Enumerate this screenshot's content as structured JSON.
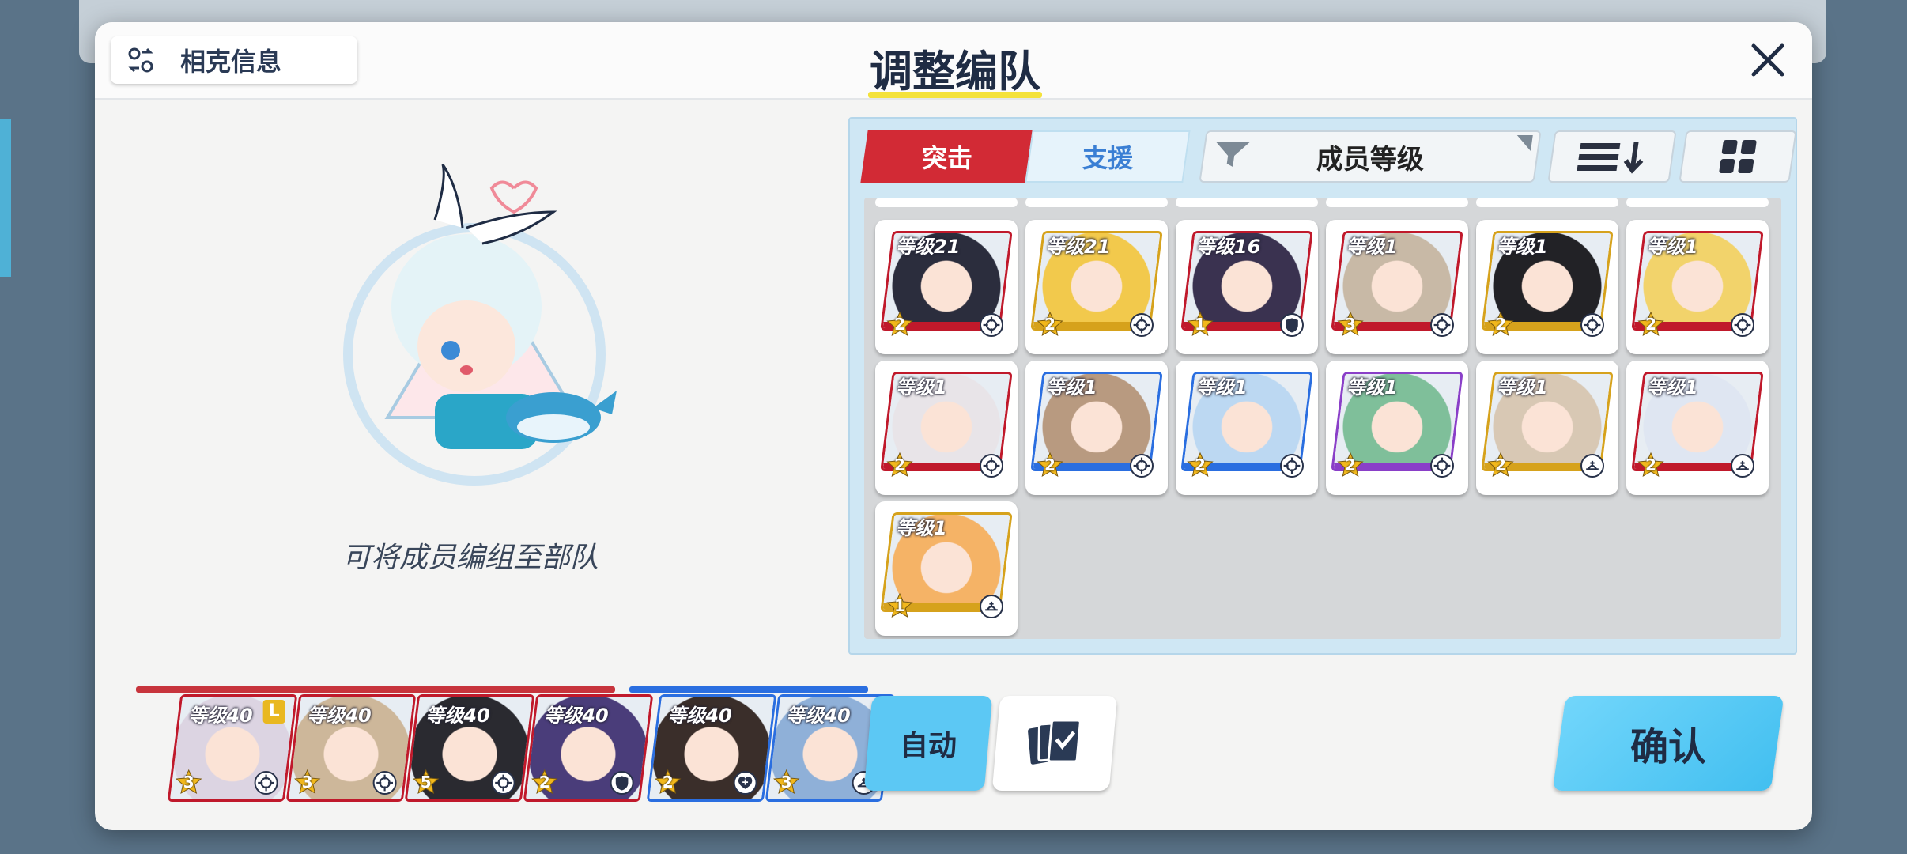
{
  "header": {
    "matchup_label": "相克信息",
    "title": "调整编队"
  },
  "left": {
    "hint": "可将成员编组至部队"
  },
  "filter": {
    "strike_label": "突击",
    "support_label": "支援",
    "sort_key": "成员等级"
  },
  "roster": [
    {
      "level": "等级21",
      "stars": "2",
      "role": "crosshair-icon",
      "frame": "#c0192b",
      "art": "#2b2d3d"
    },
    {
      "level": "等级21",
      "stars": "2",
      "role": "crosshair-icon",
      "frame": "#d6a21c",
      "art": "#f2c94c"
    },
    {
      "level": "等级16",
      "stars": "1",
      "role": "shield-icon",
      "frame": "#c0192b",
      "art": "#3a3250"
    },
    {
      "level": "等级1",
      "stars": "3",
      "role": "crosshair-icon",
      "frame": "#c0192b",
      "art": "#c8b9a6"
    },
    {
      "level": "等级1",
      "stars": "2",
      "role": "crosshair-icon",
      "frame": "#d6a21c",
      "art": "#222226"
    },
    {
      "level": "等级1",
      "stars": "2",
      "role": "crosshair-icon",
      "frame": "#c0192b",
      "art": "#f2d36b"
    },
    {
      "level": "等级1",
      "stars": "2",
      "role": "crosshair-icon",
      "frame": "#c0192b",
      "art": "#e8e4e8"
    },
    {
      "level": "等级1",
      "stars": "2",
      "role": "crosshair-icon",
      "frame": "#2a6ee0",
      "art": "#b89a80"
    },
    {
      "level": "等级1",
      "stars": "2",
      "role": "crosshair-icon",
      "frame": "#2a6ee0",
      "art": "#bcd8f2"
    },
    {
      "level": "等级1",
      "stars": "2",
      "role": "crosshair-icon",
      "frame": "#8a3fc8",
      "art": "#7fbf9a"
    },
    {
      "level": "等级1",
      "stars": "2",
      "role": "support-icon",
      "frame": "#d6a21c",
      "art": "#d8c8b4"
    },
    {
      "level": "等级1",
      "stars": "2",
      "role": "support-icon",
      "frame": "#c0192b",
      "art": "#dfe6f2"
    },
    {
      "level": "等级1",
      "stars": "1",
      "role": "support-icon",
      "frame": "#d6a21c",
      "art": "#f5b366"
    }
  ],
  "team": {
    "strikers": [
      {
        "level": "等级40",
        "stars": "3",
        "role": "crosshair-icon",
        "leader": "L",
        "art": "#dcd4e2"
      },
      {
        "level": "等级40",
        "stars": "3",
        "role": "crosshair-icon",
        "art": "#cdb79a"
      },
      {
        "level": "等级40",
        "stars": "5",
        "role": "crosshair-icon",
        "art": "#2a2a30"
      },
      {
        "level": "等级40",
        "stars": "2",
        "role": "shield-icon",
        "art": "#4a3d7a"
      }
    ],
    "specials": [
      {
        "level": "等级40",
        "stars": "2",
        "role": "heal-icon",
        "art": "#3a2e2a"
      },
      {
        "level": "等级40",
        "stars": "3",
        "role": "support-icon",
        "art": "#8fb0d8"
      }
    ]
  },
  "buttons": {
    "auto_label": "自动",
    "confirm_label": "确认"
  }
}
